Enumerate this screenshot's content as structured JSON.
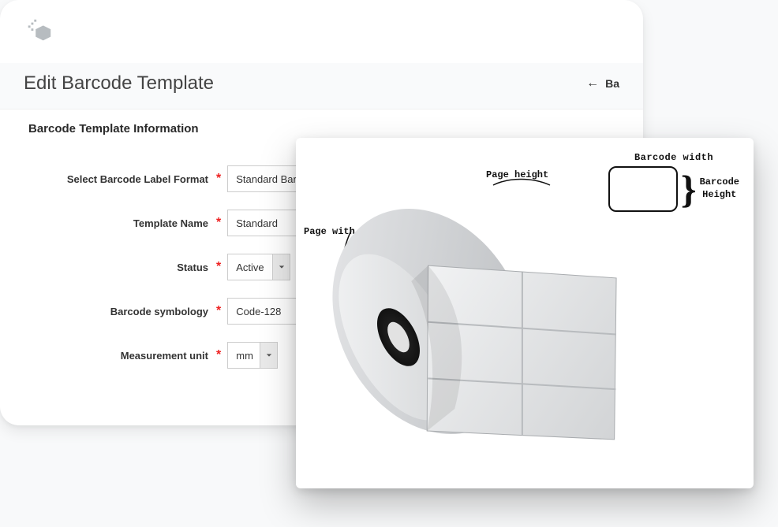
{
  "header": {
    "title": "Edit Barcode Template",
    "back_arrow": "←",
    "back_text": "Ba"
  },
  "section_title": "Barcode Template Information",
  "form": {
    "labels": {
      "format": "Select Barcode Label Format",
      "name": "Template Name",
      "status": "Status",
      "symbology": "Barcode symbology",
      "unit": "Measurement unit"
    },
    "values": {
      "format": "Standard Barcod",
      "name": "Standard",
      "status": "Active",
      "symbology": "Code-128",
      "unit": "mm"
    },
    "required_mark": "*"
  },
  "diagram": {
    "barcode_width": "Barcode width",
    "barcode_height1": "Barcode",
    "barcode_height2": "Height",
    "page_height": "Page height",
    "page_width": "Page with"
  }
}
